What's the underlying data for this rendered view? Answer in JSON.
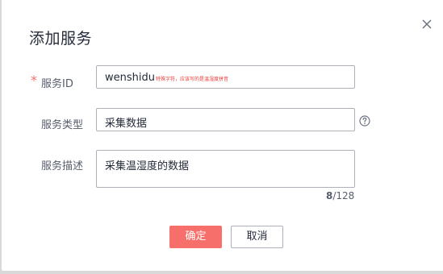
{
  "dialog": {
    "title": "添加服务",
    "close_icon": "close-icon"
  },
  "form": {
    "required_mark": "*",
    "service_id": {
      "label": "服务ID",
      "value": "wenshidu",
      "hint": "特殊字符，应该写的是温湿度拼音"
    },
    "service_type": {
      "label": "服务类型",
      "value": "采集数据",
      "help_icon": "question-circle-icon"
    },
    "service_desc": {
      "label": "服务描述",
      "value": "采集温湿度的数据",
      "counter_current": "8",
      "counter_max": "/128"
    }
  },
  "footer": {
    "ok_label": "确定",
    "cancel_label": "取消"
  },
  "colors": {
    "primary": "#f66f6a",
    "required": "#f66f6a",
    "hint": "#e53935",
    "border": "#adb0b8"
  }
}
